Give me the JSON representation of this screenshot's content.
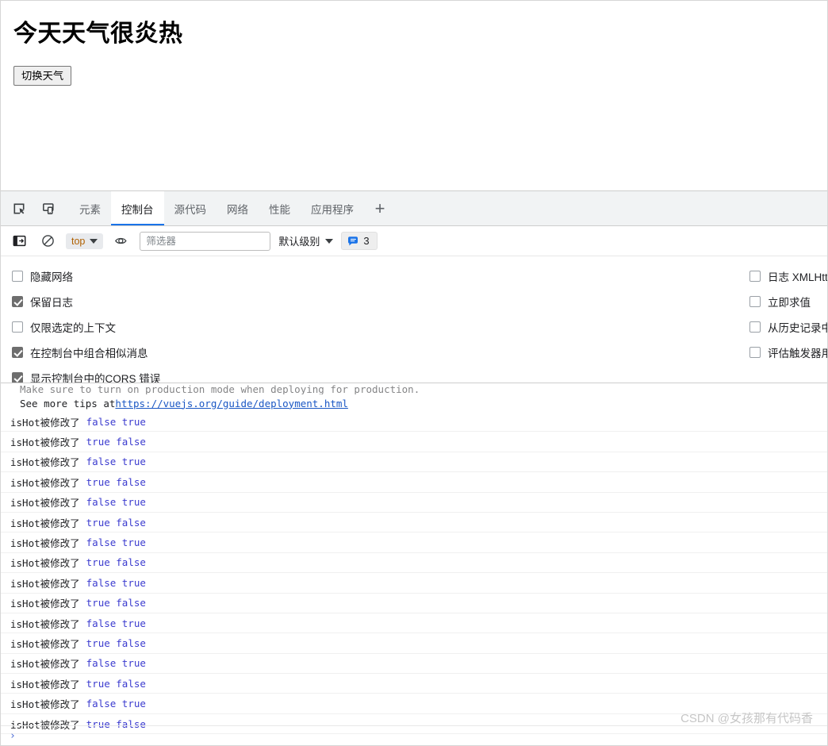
{
  "page": {
    "title": "今天天气很炎热",
    "toggle_button": "切换天气"
  },
  "devtools": {
    "tabs": [
      {
        "label": "元素",
        "active": false
      },
      {
        "label": "控制台",
        "active": true
      },
      {
        "label": "源代码",
        "active": false
      },
      {
        "label": "网络",
        "active": false
      },
      {
        "label": "性能",
        "active": false
      },
      {
        "label": "应用程序",
        "active": false
      }
    ],
    "more_tabs_label": "+",
    "icons": {
      "inspect": "inspect-element-icon",
      "device": "device-toolbar-icon",
      "sidebar": "console-sidebar-icon",
      "clear": "clear-console-icon",
      "eye": "live-expression-icon",
      "message": "info-message-icon"
    },
    "filterbar": {
      "context": "top",
      "filter_placeholder": "筛选器",
      "filter_value": "",
      "level": "默认级别",
      "message_count": "3"
    },
    "settings": {
      "left": [
        {
          "label": "隐藏网络",
          "checked": false
        },
        {
          "label": "保留日志",
          "checked": true
        },
        {
          "label": "仅限选定的上下文",
          "checked": false
        },
        {
          "label": "在控制台中组合相似消息",
          "checked": true
        },
        {
          "label": "显示控制台中的CORS 错误",
          "checked": true
        }
      ],
      "right": [
        {
          "label": "日志 XMLHttpRequests",
          "checked": false
        },
        {
          "label": "立即求值",
          "checked": false
        },
        {
          "label": "从历史记录中自动补全",
          "checked": false
        },
        {
          "label": "评估触发器用户激活",
          "checked": false
        }
      ]
    },
    "console": {
      "warning_line_1": "Make sure to turn on production mode when deploying for production.",
      "warning_line_2_prefix": "See more tips at ",
      "warning_line_2_link": "https://vuejs.org/guide/deployment.html",
      "log_label": "isHot被修改了",
      "logs": [
        {
          "label": "isHot被修改了",
          "values": "false true"
        },
        {
          "label": "isHot被修改了",
          "values": "true false"
        },
        {
          "label": "isHot被修改了",
          "values": "false true"
        },
        {
          "label": "isHot被修改了",
          "values": "true false"
        },
        {
          "label": "isHot被修改了",
          "values": "false true"
        },
        {
          "label": "isHot被修改了",
          "values": "true false"
        },
        {
          "label": "isHot被修改了",
          "values": "false true"
        },
        {
          "label": "isHot被修改了",
          "values": "true false"
        },
        {
          "label": "isHot被修改了",
          "values": "false true"
        },
        {
          "label": "isHot被修改了",
          "values": "true false"
        },
        {
          "label": "isHot被修改了",
          "values": "false true"
        },
        {
          "label": "isHot被修改了",
          "values": "true false"
        },
        {
          "label": "isHot被修改了",
          "values": "false true"
        },
        {
          "label": "isHot被修改了",
          "values": "true false"
        },
        {
          "label": "isHot被修改了",
          "values": "false true"
        },
        {
          "label": "isHot被修改了",
          "values": "true false"
        }
      ],
      "prompt_symbol": "›"
    }
  },
  "watermark": "CSDN @女孩那有代码香",
  "colors": {
    "accent_blue": "#1a73e8",
    "keyword_blue": "#3b3bcf",
    "link_blue": "#1a57c4",
    "context_orange": "#b06000",
    "tabbar_bg": "#f1f3f4"
  }
}
